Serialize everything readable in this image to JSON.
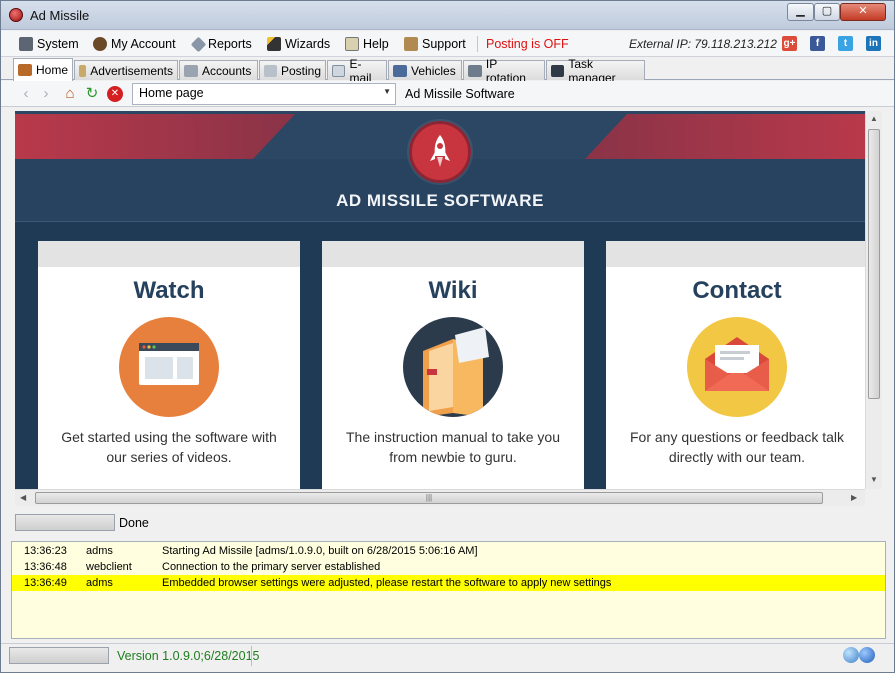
{
  "window": {
    "title": "Ad Missile"
  },
  "menu": {
    "items": [
      "System",
      "My Account",
      "Reports",
      "Wizards",
      "Help",
      "Support"
    ],
    "posting_status": "Posting is OFF",
    "external_ip": "External IP: 79.118.213.212",
    "social": [
      "g+",
      "f",
      "t",
      "in"
    ]
  },
  "tabs": [
    "Home",
    "Advertisements",
    "Accounts",
    "Posting",
    "E-mail",
    "Vehicles",
    "IP rotation",
    "Task manager"
  ],
  "nav": {
    "address": "Home page",
    "page_title": "Ad Missile Software"
  },
  "hero": {
    "title": "AD MISSILE SOFTWARE"
  },
  "cards": [
    {
      "title": "Watch",
      "text": "Get started using the software with our series of videos."
    },
    {
      "title": "Wiki",
      "text": "The instruction manual to take you from newbie to guru."
    },
    {
      "title": "Contact",
      "text": "For any questions or feedback talk directly with our team."
    }
  ],
  "browser_status": "Done",
  "log": [
    {
      "time": "13:36:23",
      "source": "adms",
      "message": "Starting Ad Missile [adms/1.0.9.0, built on 6/28/2015 5:06:16 AM]"
    },
    {
      "time": "13:36:48",
      "source": "webclient",
      "message": "Connection to the primary server established"
    },
    {
      "time": "13:36:49",
      "source": "adms",
      "message": "Embedded browser settings were adjusted, please restart the software to apply new settings"
    }
  ],
  "version": "Version 1.0.9.0;6/28/2015",
  "colors": {
    "hero_dark": "#28435f",
    "accent_red": "#c9353f",
    "log_bg": "#ffffe0",
    "log_highlight": "#ffff00",
    "posting_off": "#e01010"
  }
}
